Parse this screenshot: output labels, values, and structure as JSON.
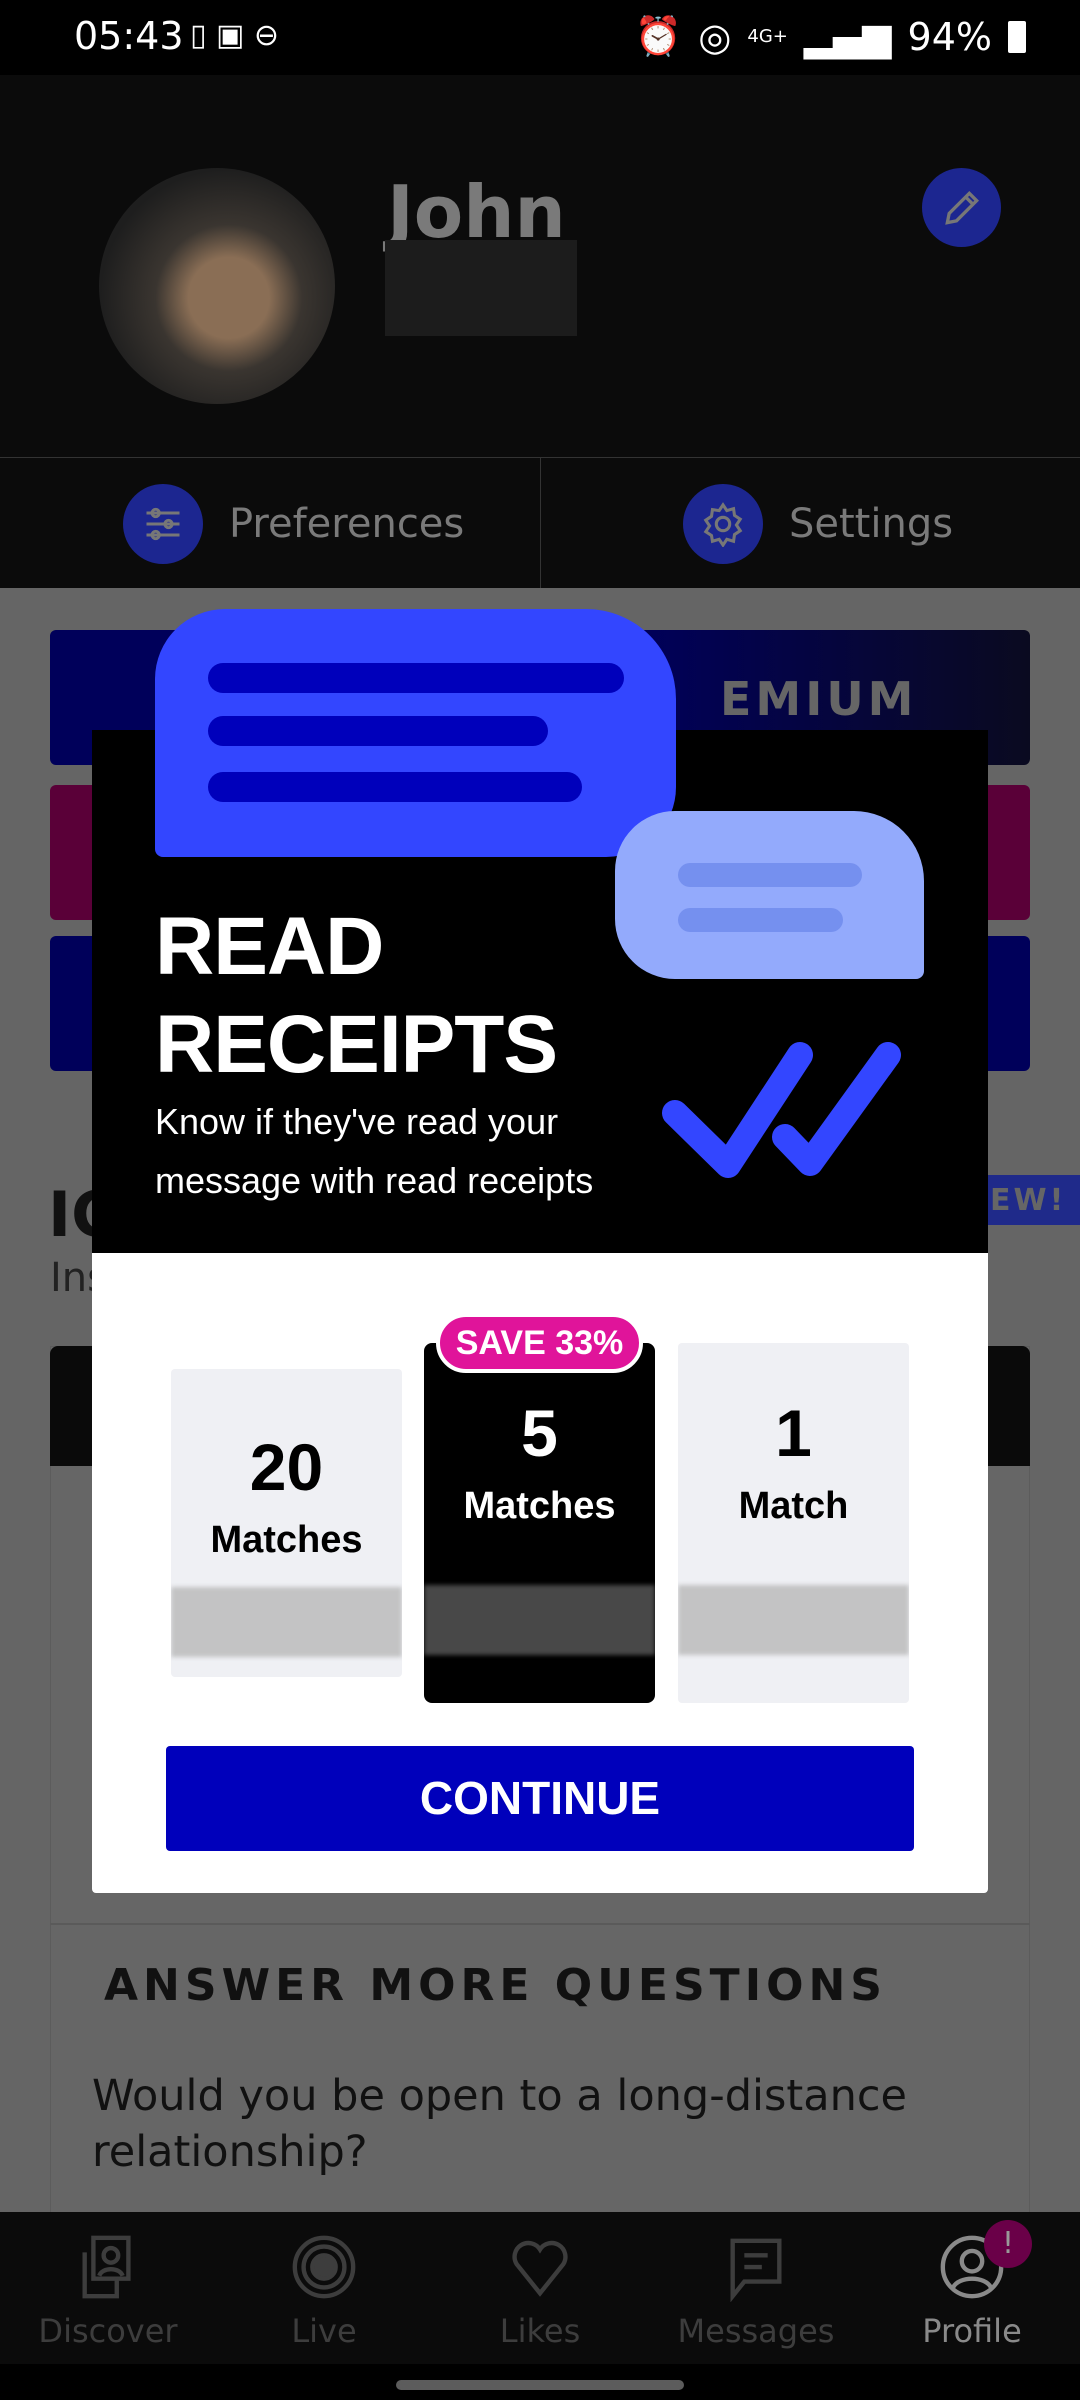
{
  "status_bar": {
    "time": "05:43",
    "network": "4G+",
    "battery": "94%"
  },
  "profile": {
    "name": "John"
  },
  "tabs": [
    {
      "label": "Preferences",
      "icon": "sliders-icon"
    },
    {
      "label": "Settings",
      "icon": "gear-icon"
    }
  ],
  "background": {
    "premium_label": "EMIUM",
    "ic_title": "IC",
    "ic_sub": "Ins",
    "new_badge": "EW!",
    "section_title": "ANSWER MORE QUESTIONS",
    "question": "Would you be open to a long-distance relationship?"
  },
  "modal": {
    "title_line1": "READ",
    "title_line2": "RECEIPTS",
    "subtitle_line1": "Know if they've read your",
    "subtitle_line2": "message with read receipts",
    "plans": [
      {
        "count": "20",
        "unit": "Matches"
      },
      {
        "count": "5",
        "unit": "Matches",
        "selected": true,
        "badge": "SAVE 33%"
      },
      {
        "count": "1",
        "unit": "Match"
      }
    ],
    "continue_label": "CONTINUE",
    "colors": {
      "accent": "#0000bb",
      "badge": "#e0149a",
      "bubble": "#3346ff"
    }
  },
  "nav": [
    {
      "label": "Discover"
    },
    {
      "label": "Live"
    },
    {
      "label": "Likes"
    },
    {
      "label": "Messages"
    },
    {
      "label": "Profile",
      "active": true,
      "badge": "!"
    }
  ]
}
